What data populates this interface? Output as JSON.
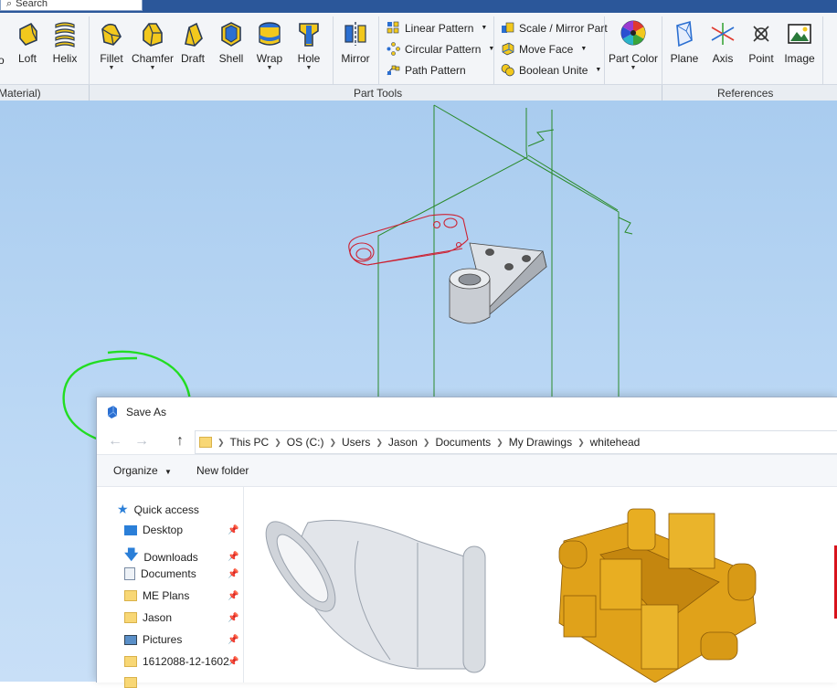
{
  "search": {
    "placeholder": "Search"
  },
  "ribbon": {
    "tools_left": [
      {
        "label": "Loft",
        "icon": "loft-icon"
      },
      {
        "label": "Helix",
        "icon": "helix-icon"
      },
      {
        "label": "Fillet",
        "icon": "fillet-icon"
      },
      {
        "label": "Chamfer",
        "icon": "chamfer-icon"
      },
      {
        "label": "Draft",
        "icon": "draft-icon"
      },
      {
        "label": "Shell",
        "icon": "shell-icon"
      },
      {
        "label": "Wrap",
        "icon": "wrap-icon"
      },
      {
        "label": "Hole",
        "icon": "hole-icon"
      },
      {
        "label": "Mirror",
        "icon": "mirror-icon"
      }
    ],
    "pattern_tools": [
      {
        "label": "Linear Pattern",
        "icon": "linear-pattern-icon"
      },
      {
        "label": "Circular Pattern",
        "icon": "circular-pattern-icon"
      },
      {
        "label": "Path Pattern",
        "icon": "path-pattern-icon"
      }
    ],
    "face_tools": [
      {
        "label": "Scale / Mirror Part",
        "icon": "scale-mirror-icon"
      },
      {
        "label": "Move Face",
        "icon": "move-face-icon"
      },
      {
        "label": "Boolean Unite",
        "icon": "boolean-unite-icon"
      }
    ],
    "part_color": {
      "label": "Part Color",
      "icon": "color-wheel-icon"
    },
    "references": [
      {
        "label": "Plane",
        "icon": "plane-icon"
      },
      {
        "label": "Axis",
        "icon": "axis-icon"
      },
      {
        "label": "Point",
        "icon": "point-icon"
      },
      {
        "label": "Image",
        "icon": "image-icon"
      }
    ],
    "groups": {
      "left": "Material)",
      "part_tools": "Part Tools",
      "references": "References"
    },
    "edge_label": "o"
  },
  "dialog": {
    "title": "Save As",
    "breadcrumb": [
      "This PC",
      "OS (C:)",
      "Users",
      "Jason",
      "Documents",
      "My Drawings",
      "whitehead"
    ],
    "organize": "Organize",
    "new_folder": "New folder",
    "nav": [
      {
        "label": "Quick access",
        "icon": "star-icon",
        "pinned": false
      },
      {
        "label": "Desktop",
        "icon": "desktop-icon",
        "pinned": true
      },
      {
        "label": "Downloads",
        "icon": "download-icon",
        "pinned": true
      },
      {
        "label": "Documents",
        "icon": "documents-icon",
        "pinned": true
      },
      {
        "label": "ME Plans",
        "icon": "folder-icon",
        "pinned": true
      },
      {
        "label": "Jason",
        "icon": "folder-icon",
        "pinned": true
      },
      {
        "label": "Pictures",
        "icon": "pictures-icon",
        "pinned": true
      },
      {
        "label": "1612088-12-1602",
        "icon": "folder-icon",
        "pinned": true
      }
    ]
  },
  "colors": {
    "annotation_circle": "#22dd22",
    "sketch": "#cc2233",
    "construction": "#2a8a2a",
    "part_orange": "#e0a21a"
  }
}
